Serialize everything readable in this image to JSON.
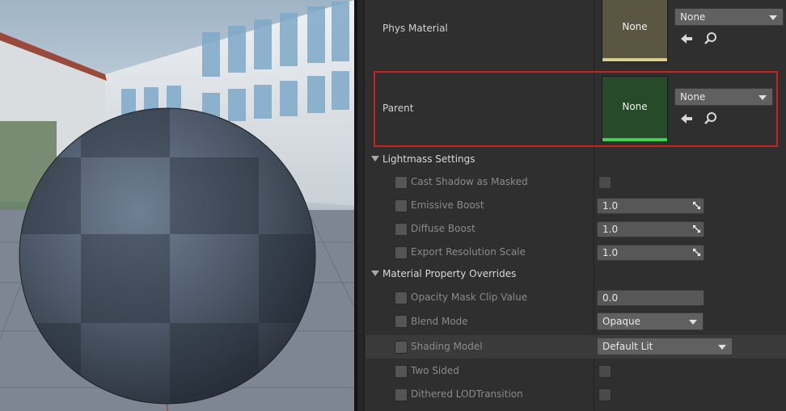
{
  "phys_material": {
    "label": "Phys Material",
    "thumbnail_text": "None",
    "dropdown_value": "None",
    "thumbnail_color": "#5a5642",
    "bar_color": "#d8cf8a"
  },
  "parent": {
    "label": "Parent",
    "thumbnail_text": "None",
    "dropdown_value": "None",
    "thumbnail_color": "#264a2a",
    "bar_color": "#3fd44f"
  },
  "lightmass": {
    "title": "Lightmass Settings",
    "rows": [
      {
        "label": "Cast Shadow as Masked",
        "value": ""
      },
      {
        "label": "Emissive Boost",
        "value": "1.0"
      },
      {
        "label": "Diffuse Boost",
        "value": "1.0"
      },
      {
        "label": "Export Resolution Scale",
        "value": "1.0"
      }
    ]
  },
  "overrides": {
    "title": "Material Property Overrides",
    "opacity_mask": {
      "label": "Opacity Mask Clip Value",
      "value": "0.0"
    },
    "blend_mode": {
      "label": "Blend Mode",
      "value": "Opaque"
    },
    "shading_model": {
      "label": "Shading Model",
      "value": "Default Lit"
    },
    "two_sided": {
      "label": "Two Sided"
    },
    "dithered": {
      "label": "Dithered LODTransition"
    }
  },
  "icons": {
    "use_selected": "arrow-left-icon",
    "browse": "search-icon",
    "reset": "expand-corner-icon"
  },
  "colors": {
    "highlight": "#cc1f1f",
    "panel_bg": "#2f2f2f"
  }
}
